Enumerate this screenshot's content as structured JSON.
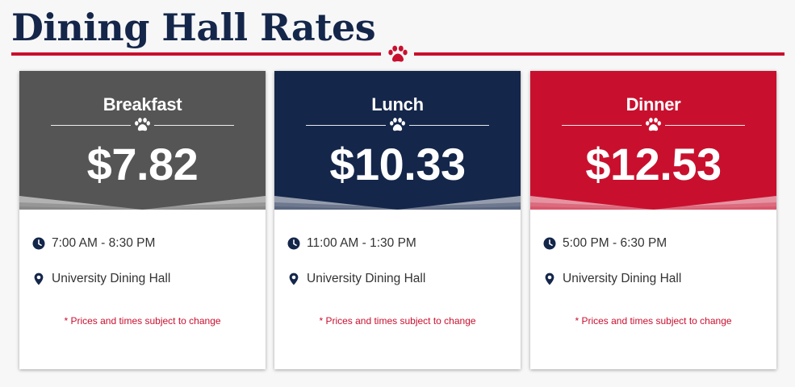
{
  "page": {
    "title": "Dining Hall Rates"
  },
  "colors": {
    "navy": "#14264a",
    "red": "#c8102e",
    "gray": "#555555",
    "white": "#ffffff"
  },
  "icons": {
    "title": "paw-icon",
    "time": "clock-icon",
    "location": "map-pin-icon"
  },
  "cards": [
    {
      "meal": "Breakfast",
      "price": "$7.82",
      "time": "7:00 AM - 8:30 PM",
      "location": "University Dining Hall",
      "note": "* Prices and times subject to change",
      "color": "#555555"
    },
    {
      "meal": "Lunch",
      "price": "$10.33",
      "time": "11:00 AM - 1:30 PM",
      "location": "University Dining Hall",
      "note": "* Prices and times subject to change",
      "color": "#14264a"
    },
    {
      "meal": "Dinner",
      "price": "$12.53",
      "time": "5:00 PM - 6:30 PM",
      "location": "University Dining Hall",
      "note": "* Prices and times subject to change",
      "color": "#c8102e"
    }
  ]
}
